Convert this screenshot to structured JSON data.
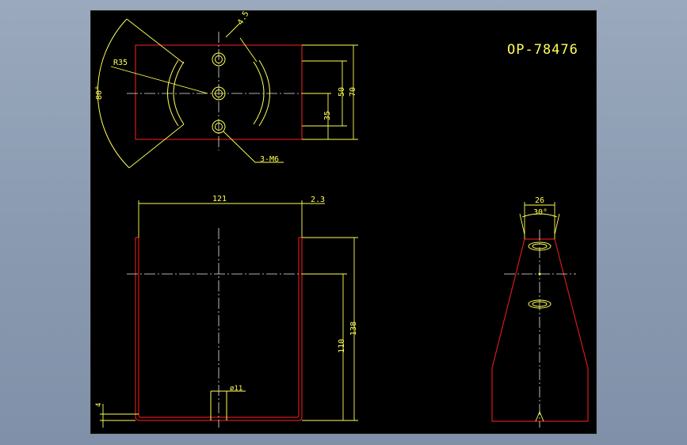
{
  "drawing": {
    "part_number": "OP-78476",
    "colors": {
      "outline": "#d41a1a",
      "dimension": "#ffff55",
      "centerline": "#e8e8e8",
      "background": "#000000"
    },
    "top_view": {
      "radius_label": "R35",
      "angle_label": "80°",
      "thread_label": "3-M6",
      "slot_width_label": "4.5",
      "dim_50": "50",
      "dim_70": "70",
      "dim_35": "35"
    },
    "front_view": {
      "width_label": "121",
      "thickness_label": "2.3",
      "height_label": "138",
      "hole_height_label": "110",
      "hole_diameter_label": "ø11",
      "base_label": "4"
    },
    "side_view": {
      "top_width_label": "26",
      "angle_label": "30°"
    }
  }
}
